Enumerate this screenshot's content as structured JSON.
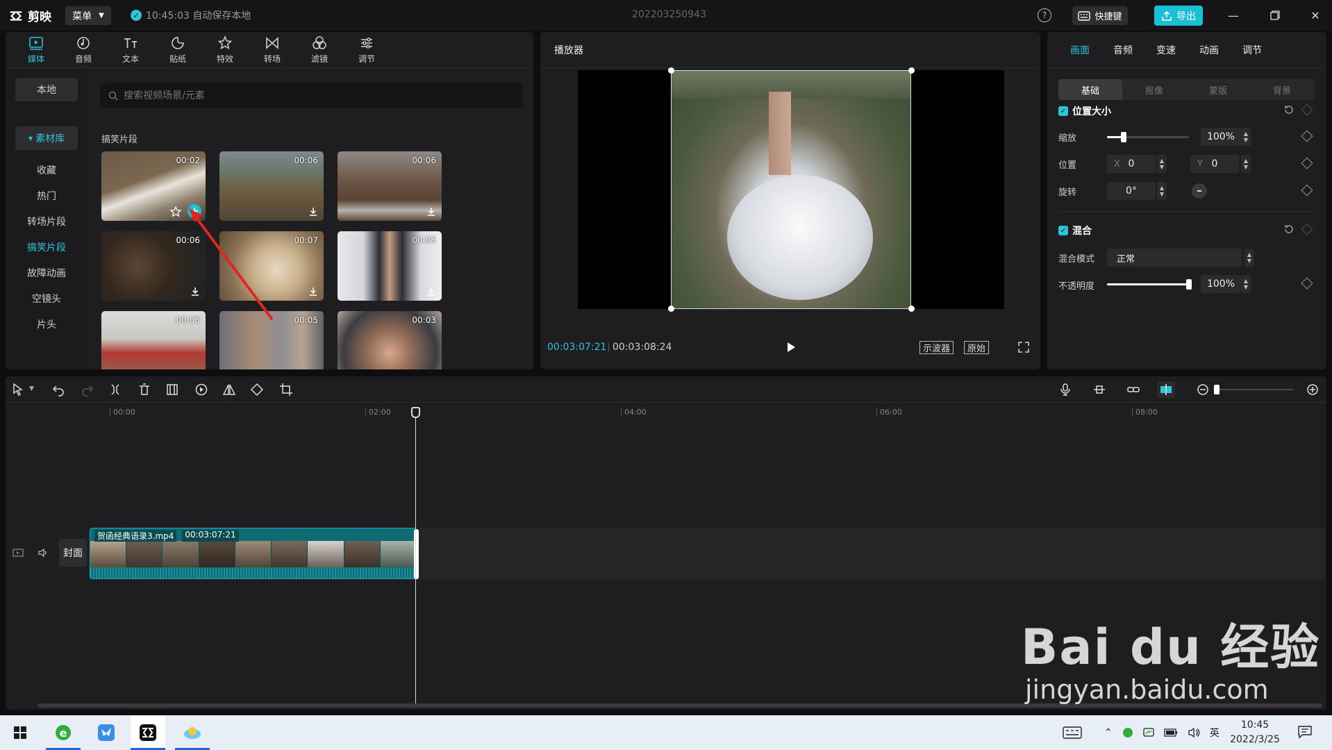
{
  "titlebar": {
    "app_name": "剪映",
    "menu_label": "菜单",
    "autosave_text": "10:45:03 自动保存本地",
    "project_name": "202203250943",
    "shortcut_label": "快捷键",
    "export_label": "导出"
  },
  "media": {
    "tabs": [
      {
        "label": "媒体",
        "icon": "media-icon",
        "active": true
      },
      {
        "label": "音频",
        "icon": "audio-icon"
      },
      {
        "label": "文本",
        "icon": "text-icon"
      },
      {
        "label": "贴纸",
        "icon": "sticker-icon"
      },
      {
        "label": "特效",
        "icon": "effects-icon"
      },
      {
        "label": "转场",
        "icon": "transition-icon"
      },
      {
        "label": "滤镜",
        "icon": "filter-icon"
      },
      {
        "label": "调节",
        "icon": "adjust-icon"
      }
    ],
    "nav": [
      "本地",
      "素材库",
      "收藏",
      "热门",
      "转场片段",
      "搞笑片段",
      "故障动画",
      "空镜头",
      "片头"
    ],
    "search_placeholder": "搜索视频场景/元素",
    "section_title": "搞笑片段",
    "thumbnails": [
      {
        "duration": "00:02"
      },
      {
        "duration": "00:06"
      },
      {
        "duration": "00:06"
      },
      {
        "duration": "00:06"
      },
      {
        "duration": "00:07"
      },
      {
        "duration": "00:05"
      },
      {
        "duration": "00:05"
      },
      {
        "duration": "00:05"
      },
      {
        "duration": "00:03"
      }
    ]
  },
  "player": {
    "title": "播放器",
    "current_time": "00:03:07:21",
    "total_time": "00:03:08:24",
    "scope_label": "示波器",
    "ratio_label": "原始"
  },
  "props": {
    "tabs": [
      "画面",
      "音频",
      "变速",
      "动画",
      "调节"
    ],
    "subtabs": [
      "基础",
      "抠像",
      "蒙版",
      "背景"
    ],
    "position_section": "位置大小",
    "scale_label": "缩放",
    "scale_value": "100%",
    "scale_fraction": 0.2,
    "position_label": "位置",
    "x_axis": "X",
    "x_value": "0",
    "y_axis": "Y",
    "y_value": "0",
    "rotation_label": "旋转",
    "rotation_value": "0°",
    "blend_section": "混合",
    "blend_mode_label": "混合模式",
    "blend_mode_value": "正常",
    "opacity_label": "不透明度",
    "opacity_value": "100%",
    "opacity_fraction": 1.0
  },
  "timeline": {
    "ticks": [
      "00:00",
      "02:00",
      "04:00",
      "06:00",
      "08:00"
    ],
    "clip_name": "贺函经典语录3.mp4",
    "clip_duration": "00:03:07:21",
    "cover_label": "封面"
  },
  "taskbar": {
    "ime_label": "英",
    "time": "10:45",
    "date": "2022/3/25"
  },
  "watermark": {
    "main": "Bai du 经验",
    "sub": "jingyan.baidu.com"
  },
  "colors": {
    "accent": "#2ec4d6",
    "export": "#19bfd2",
    "clip": "#0f6b73",
    "annotation_arrow": "#e0261f"
  }
}
